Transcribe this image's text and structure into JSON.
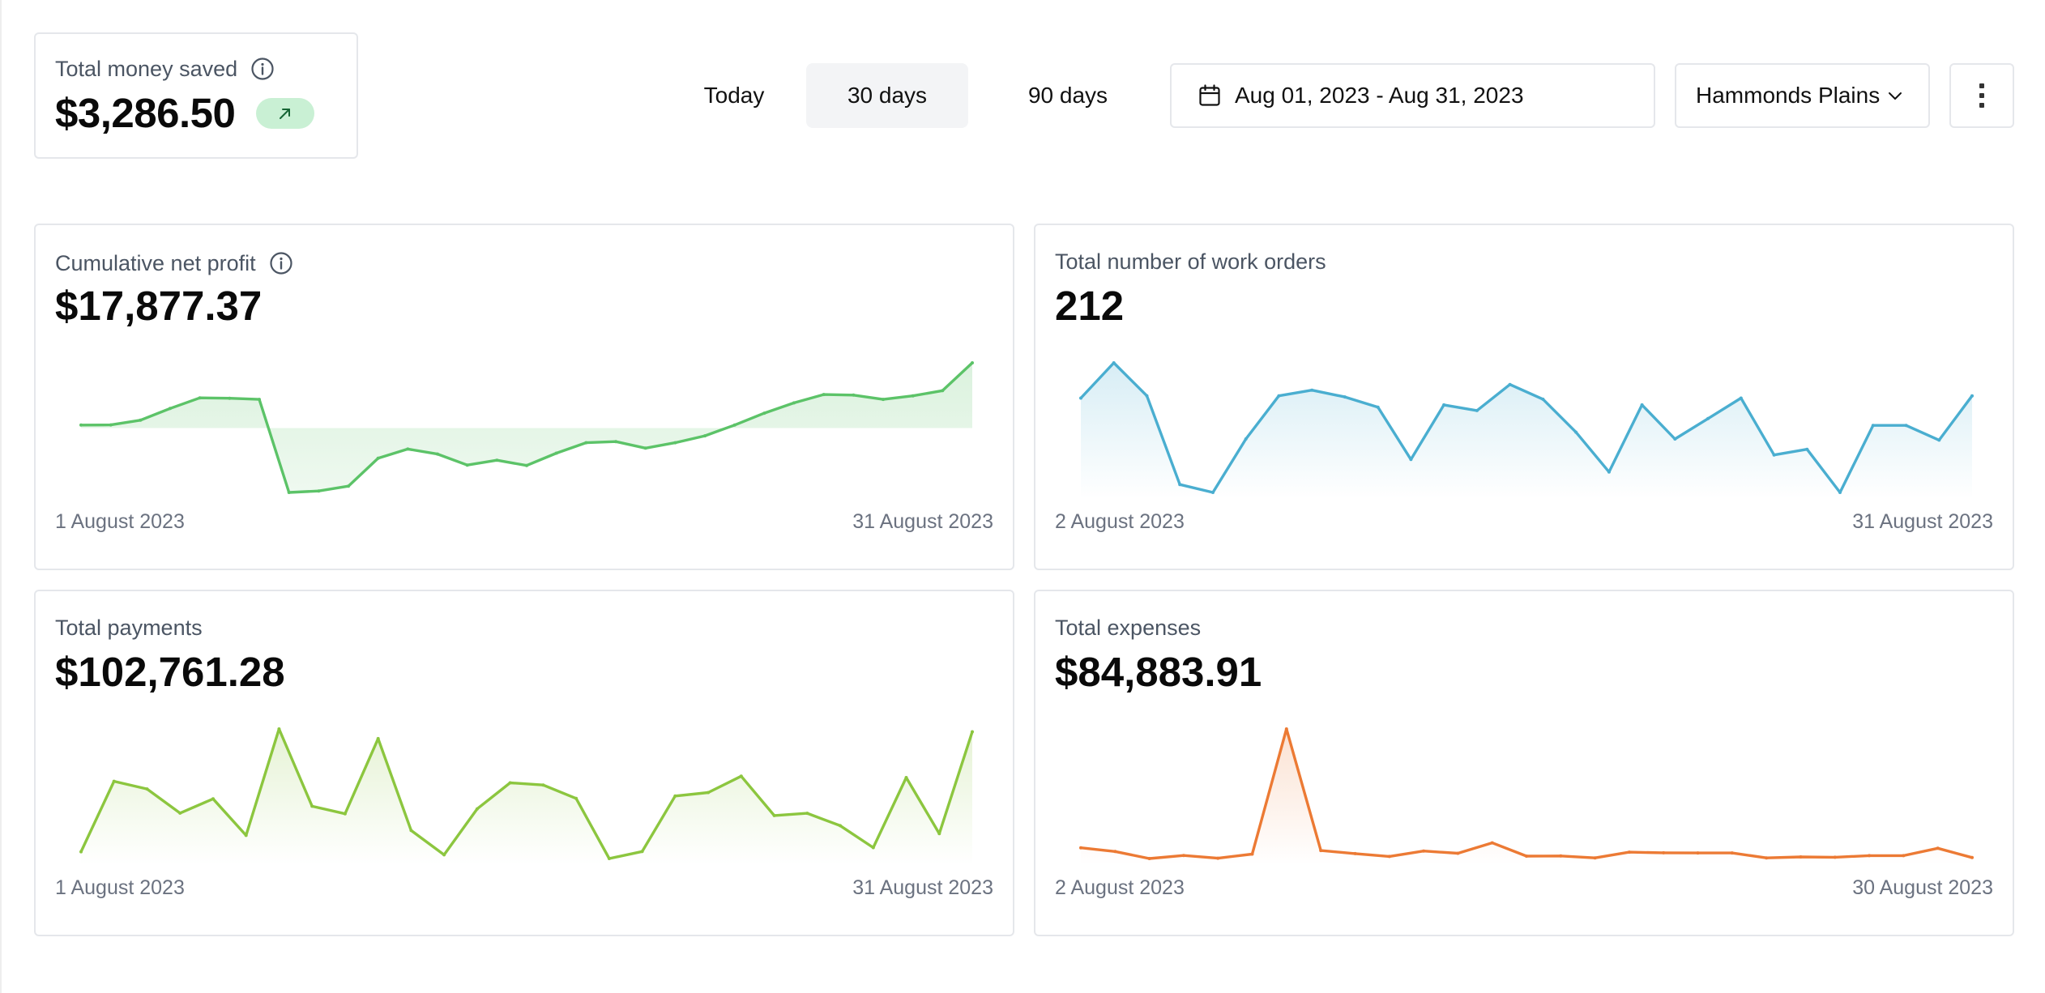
{
  "summary": {
    "title": "Total money saved",
    "value": "$3,286.50",
    "trend": "up"
  },
  "toolbar": {
    "periods": [
      "Today",
      "30 days",
      "90 days"
    ],
    "active_period": "30 days",
    "date_range": "Aug 01, 2023 - Aug 31, 2023",
    "location": "Hammonds Plains"
  },
  "cards": [
    {
      "title": "Cumulative net profit",
      "value": "$17,877.37",
      "start_label": "1 August 2023",
      "end_label": "31 August 2023",
      "color": "#5cc368"
    },
    {
      "title": "Total number of work orders",
      "value": "212",
      "start_label": "2 August 2023",
      "end_label": "31 August 2023",
      "color": "#4aaed0"
    },
    {
      "title": "Total payments",
      "value": "$102,761.28",
      "start_label": "1 August 2023",
      "end_label": "31 August 2023",
      "color": "#8cc63f"
    },
    {
      "title": "Total expenses",
      "value": "$84,883.91",
      "start_label": "2 August 2023",
      "end_label": "30 August 2023",
      "color": "#ec7a34"
    }
  ],
  "chart_data": [
    {
      "type": "area",
      "title": "Cumulative net profit",
      "baseline": 0,
      "x": [
        "1 August 2023",
        "2",
        "3",
        "4",
        "5",
        "6",
        "7",
        "8",
        "9",
        "10",
        "11",
        "12",
        "13",
        "14",
        "15",
        "16",
        "17",
        "18",
        "19",
        "20",
        "21",
        "22",
        "23",
        "24",
        "25",
        "26",
        "27",
        "28",
        "29",
        "30",
        "31 August 2023"
      ],
      "values": [
        1.6,
        1.7,
        4.2,
        10.5,
        16.2,
        16.0,
        15.4,
        -34.6,
        -33.8,
        -31.2,
        -16.2,
        -11.3,
        -14.0,
        -19.9,
        -17.3,
        -20.1,
        -13.5,
        -7.9,
        -7.3,
        -10.8,
        -7.9,
        -4.2,
        1.6,
        8.0,
        13.5,
        18.0,
        17.7,
        15.4,
        17.3,
        20.1,
        35.0
      ]
    },
    {
      "type": "area",
      "title": "Total number of work orders",
      "x": [
        "2 August 2023",
        "3",
        "4",
        "5",
        "6",
        "7",
        "8",
        "9",
        "10",
        "11",
        "12",
        "13",
        "14",
        "15",
        "16",
        "17",
        "18",
        "19",
        "20",
        "21",
        "22",
        "23",
        "24",
        "25",
        "26",
        "27",
        "28",
        "29",
        "30",
        "31 August 2023"
      ],
      "values": [
        9.2,
        12.3,
        9.4,
        1.6,
        0.9,
        5.6,
        9.4,
        9.9,
        9.3,
        8.4,
        3.8,
        8.6,
        8.1,
        10.4,
        9.1,
        6.2,
        2.7,
        8.6,
        5.6,
        7.4,
        9.2,
        4.2,
        4.7,
        0.9,
        6.8,
        6.8,
        5.5,
        9.4
      ]
    },
    {
      "type": "area",
      "title": "Total payments",
      "x": [
        "1 August 2023",
        "2",
        "3",
        "4",
        "5",
        "6",
        "7",
        "8",
        "9",
        "10",
        "11",
        "12",
        "13",
        "14",
        "15",
        "16",
        "17",
        "18",
        "19",
        "20",
        "21",
        "22",
        "23",
        "24",
        "25",
        "26",
        "27",
        "28",
        "29",
        "30",
        "31 August 2023"
      ],
      "values": [
        520,
        5210,
        4700,
        3090,
        4040,
        1610,
        8690,
        3550,
        3050,
        8050,
        1940,
        320,
        3370,
        5110,
        4960,
        4070,
        70,
        540,
        4230,
        4460,
        5550,
        2930,
        3080,
        2260,
        800,
        5460,
        1730,
        8500
      ]
    },
    {
      "type": "area",
      "title": "Total expenses",
      "x": [
        "2 August 2023",
        "3",
        "4",
        "5",
        "6",
        "7",
        "8",
        "9",
        "10",
        "11",
        "12",
        "13",
        "14",
        "15",
        "16",
        "17",
        "18",
        "19",
        "20",
        "21",
        "22",
        "23",
        "24",
        "25",
        "26",
        "27",
        "28",
        "29",
        "30 August 2023"
      ],
      "values": [
        1190,
        960,
        520,
        710,
        540,
        800,
        8600,
        1020,
        830,
        650,
        990,
        850,
        1500,
        670,
        680,
        560,
        920,
        880,
        870,
        870,
        560,
        620,
        600,
        700,
        700,
        1160,
        580
      ]
    }
  ]
}
